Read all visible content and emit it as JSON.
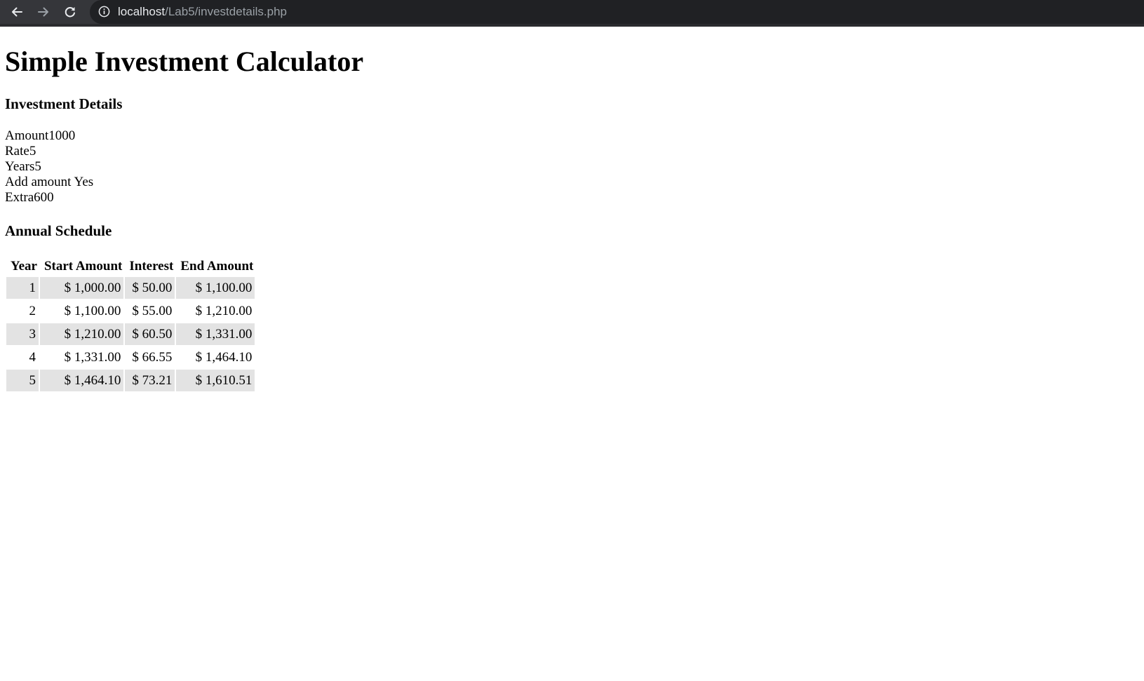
{
  "browser": {
    "url_host": "localhost",
    "url_path": "/Lab5/investdetails.php"
  },
  "page": {
    "title": "Simple Investment Calculator",
    "details_heading": "Investment Details",
    "details": [
      "Amount1000",
      "Rate5",
      "Years5",
      "Add amount Yes",
      "Extra600"
    ],
    "schedule_heading": "Annual Schedule",
    "table": {
      "headers": [
        "Year",
        "Start Amount",
        "Interest",
        "End Amount"
      ],
      "rows": [
        [
          "1",
          "$ 1,000.00",
          "$ 50.00",
          "$ 1,100.00"
        ],
        [
          "2",
          "$ 1,100.00",
          "$ 55.00",
          "$ 1,210.00"
        ],
        [
          "3",
          "$ 1,210.00",
          "$ 60.50",
          "$ 1,331.00"
        ],
        [
          "4",
          "$ 1,331.00",
          "$ 66.55",
          "$ 1,464.10"
        ],
        [
          "5",
          "$ 1,464.10",
          "$ 73.21",
          "$ 1,610.51"
        ]
      ]
    }
  },
  "colors": {
    "toolbar": "#35363a",
    "omnibox": "#202124",
    "row_shade": "#e3e3e3"
  }
}
